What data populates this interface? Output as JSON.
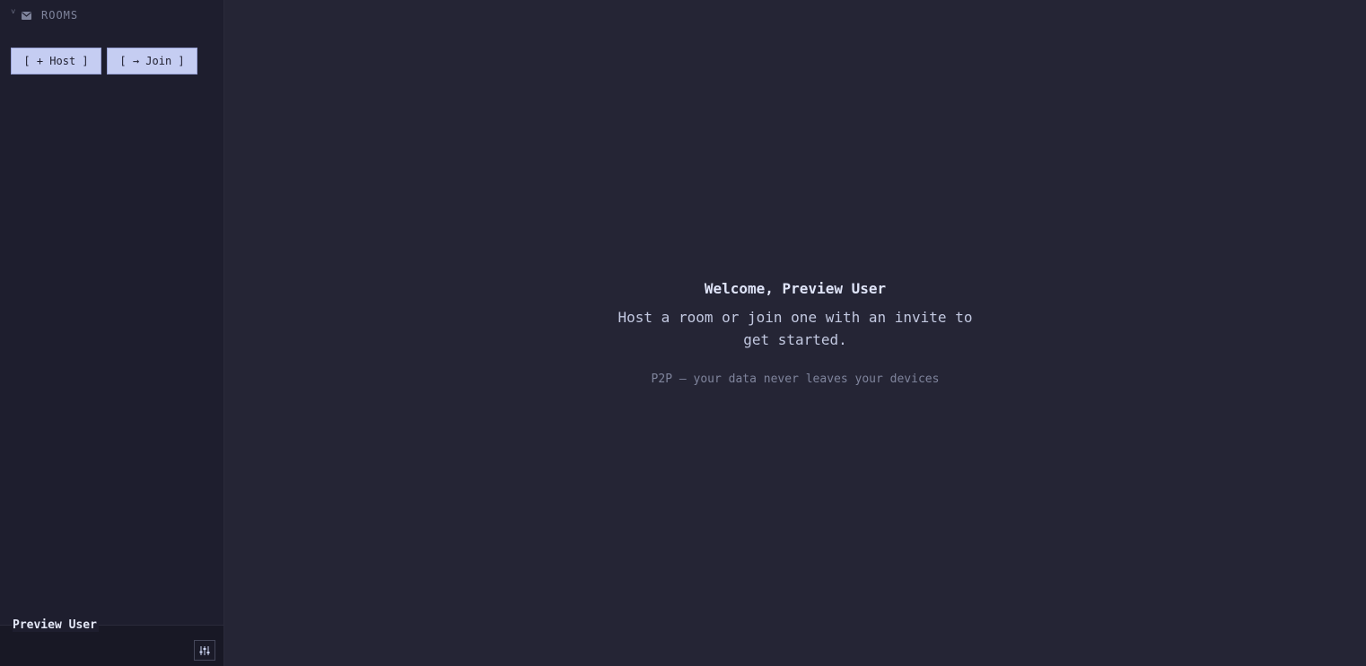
{
  "sidebar": {
    "rooms_label": "ROOMS",
    "chevron_glyph": "˅",
    "host_button": "[ + Host ]",
    "join_button": "[ → Join ]"
  },
  "user": {
    "name": "Preview User"
  },
  "main": {
    "title": "Welcome, Preview User",
    "subtitle": "Host a room or join one with an invite to get started.",
    "note": "P2P — your data never leaves your devices"
  },
  "colors": {
    "sidebar_bg": "#1e1e2e",
    "main_bg": "#252535",
    "button_bg": "#c5cdf2",
    "text_muted": "#7f849c"
  },
  "icons": [
    "chevron-down-icon",
    "mail-icon",
    "sliders-icon"
  ]
}
